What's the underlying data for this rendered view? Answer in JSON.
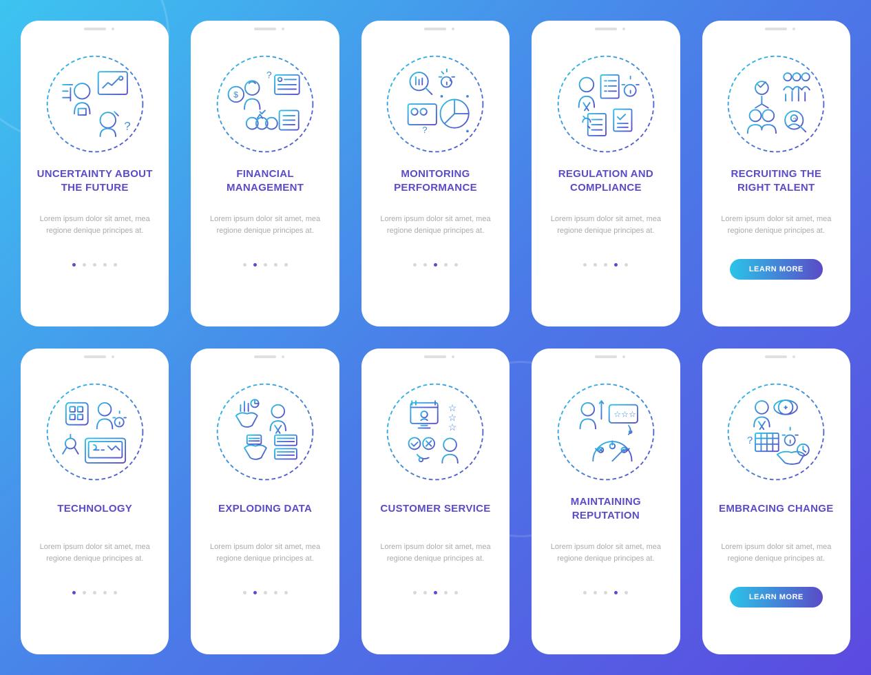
{
  "desc": "Lorem ipsum dolor sit amet, mea regione denique principes at.",
  "btn": "LEARN MORE",
  "cards": [
    {
      "title": "UNCERTAINTY ABOUT\nTHE FUTURE",
      "active": 0,
      "cta": false
    },
    {
      "title": "FINANCIAL\nMANAGEMENT",
      "active": 1,
      "cta": false
    },
    {
      "title": "MONITORING\nPERFORMANCE",
      "active": 2,
      "cta": false
    },
    {
      "title": "REGULATION AND\nCOMPLIANCE",
      "active": 3,
      "cta": false
    },
    {
      "title": "RECRUITING THE\nRIGHT TALENT",
      "active": 4,
      "cta": true
    },
    {
      "title": "TECHNOLOGY",
      "active": 0,
      "cta": false
    },
    {
      "title": "EXPLODING DATA",
      "active": 1,
      "cta": false
    },
    {
      "title": "CUSTOMER SERVICE",
      "active": 2,
      "cta": false
    },
    {
      "title": "MAINTAINING\nREPUTATION",
      "active": 3,
      "cta": false
    },
    {
      "title": "EMBRACING CHANGE",
      "active": 4,
      "cta": true
    }
  ]
}
